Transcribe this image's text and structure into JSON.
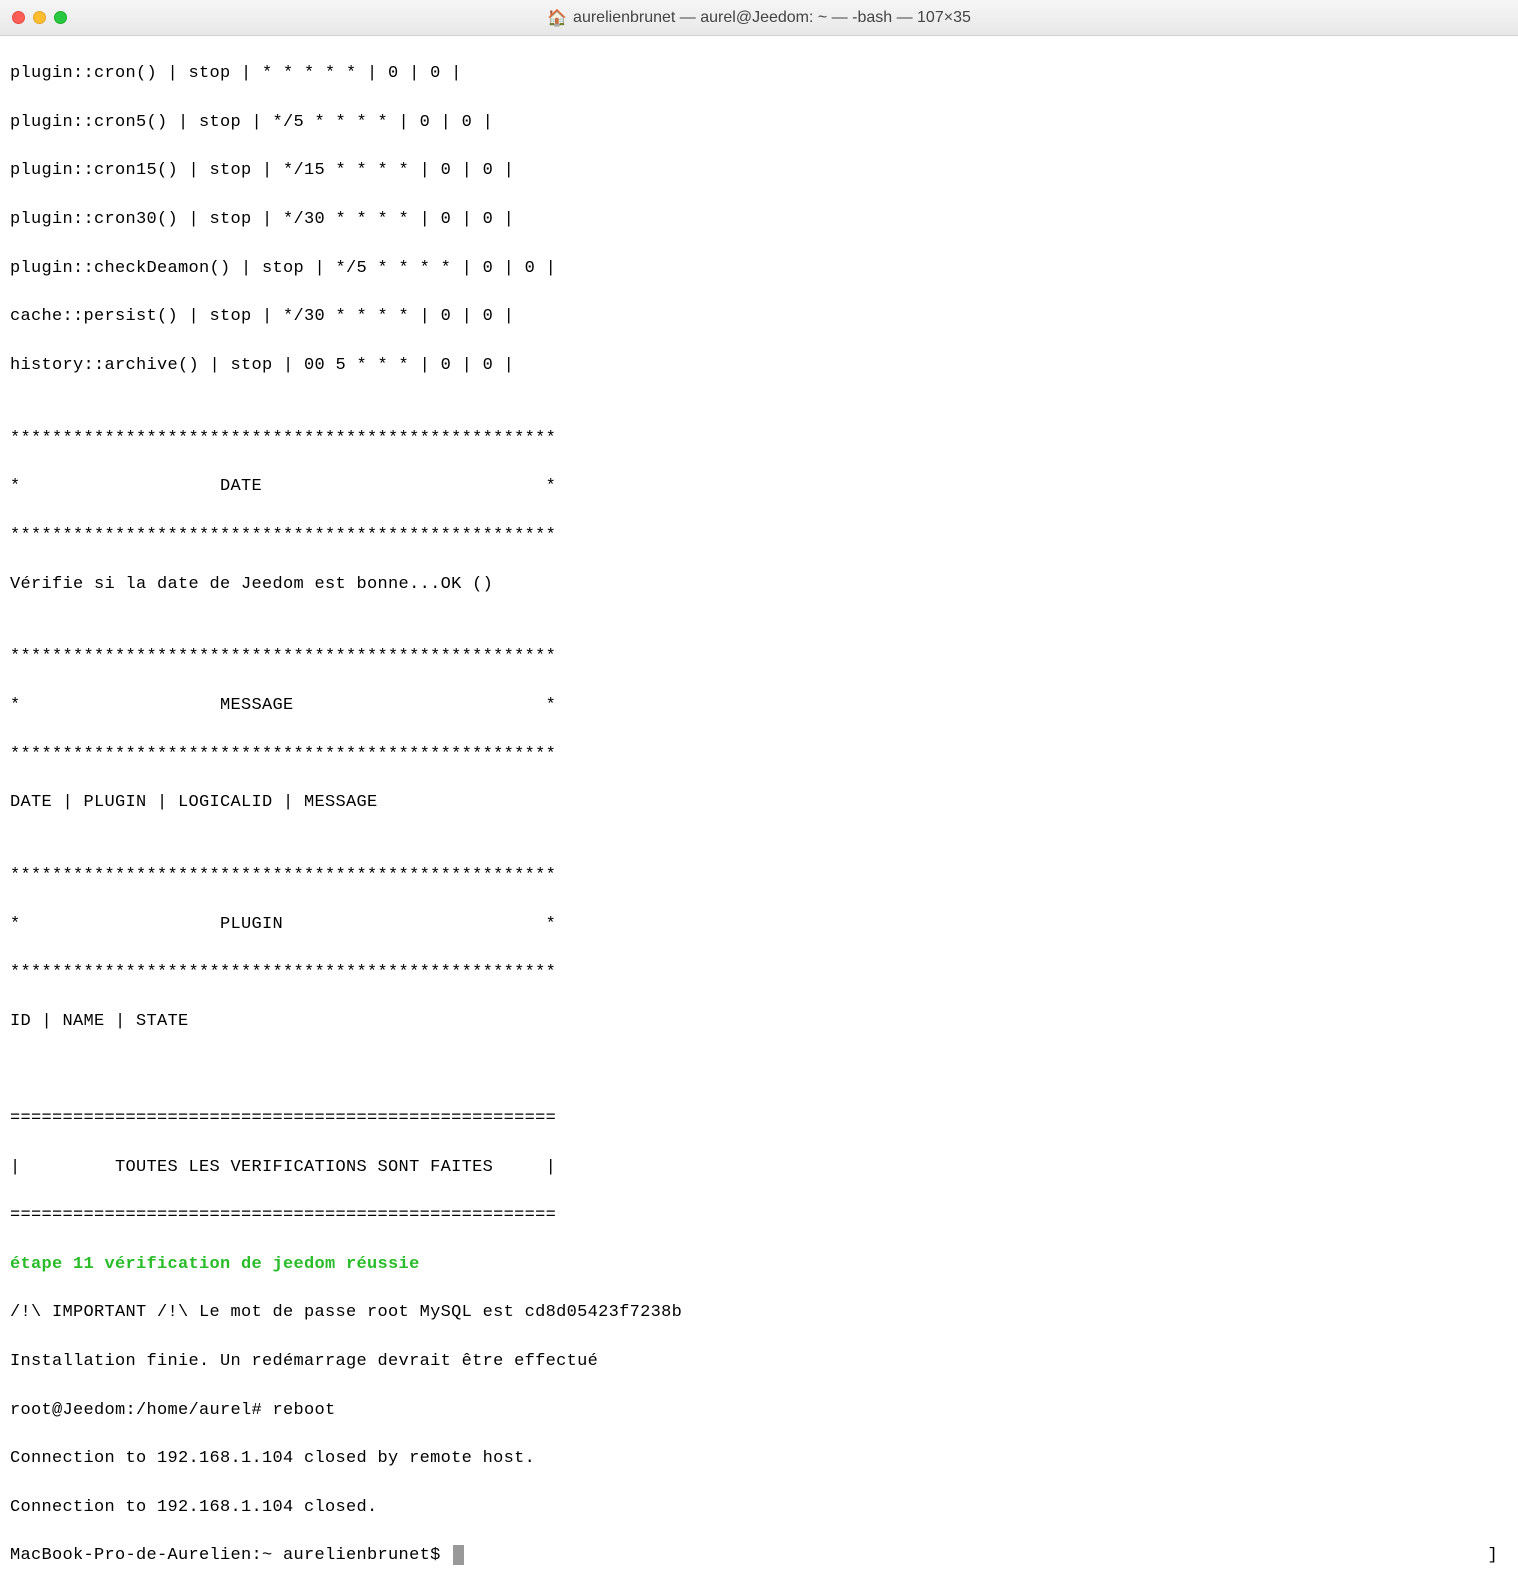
{
  "titlebar": {
    "icon": "🏠",
    "title": "aurelienbrunet — aurel@Jeedom: ~ — -bash — 107×35"
  },
  "lines": {
    "l01": "plugin::cron() | stop | * * * * * | 0 | 0 |",
    "l02": "plugin::cron5() | stop | */5 * * * * | 0 | 0 |",
    "l03": "plugin::cron15() | stop | */15 * * * * | 0 | 0 |",
    "l04": "plugin::cron30() | stop | */30 * * * * | 0 | 0 |",
    "l05": "plugin::checkDeamon() | stop | */5 * * * * | 0 | 0 |",
    "l06": "cache::persist() | stop | */30 * * * * | 0 | 0 |",
    "l07": "history::archive() | stop | 00 5 * * * | 0 | 0 |",
    "l08": "",
    "l09": "****************************************************",
    "l10": "*                   DATE                           *",
    "l11": "****************************************************",
    "l12": "Vérifie si la date de Jeedom est bonne...OK ()",
    "l13": "",
    "l14": "****************************************************",
    "l15": "*                   MESSAGE                        *",
    "l16": "****************************************************",
    "l17": "DATE | PLUGIN | LOGICALID | MESSAGE",
    "l18": "",
    "l19": "****************************************************",
    "l20": "*                   PLUGIN                         *",
    "l21": "****************************************************",
    "l22": "ID | NAME | STATE",
    "l23": "",
    "l24": "",
    "l25": "====================================================",
    "l26": "|         TOUTES LES VERIFICATIONS SONT FAITES     |",
    "l27": "====================================================",
    "l28": "étape 11 vérification de jeedom réussie",
    "l29": "/!\\ IMPORTANT /!\\ Le mot de passe root MySQL est cd8d05423f7238b",
    "l30": "Installation finie. Un redémarrage devrait être effectué",
    "l31a": "[",
    "l31b": "root@Jeedom:/home/aurel# reboot",
    "l32": "Connection to 192.168.1.104 closed by remote host.",
    "l33": "Connection to 192.168.1.104 closed.",
    "l34a": "[",
    "l34b": "MacBook-Pro-de-Aurelien:~ aurelienbrunet$ ",
    "rbracket": "]"
  }
}
